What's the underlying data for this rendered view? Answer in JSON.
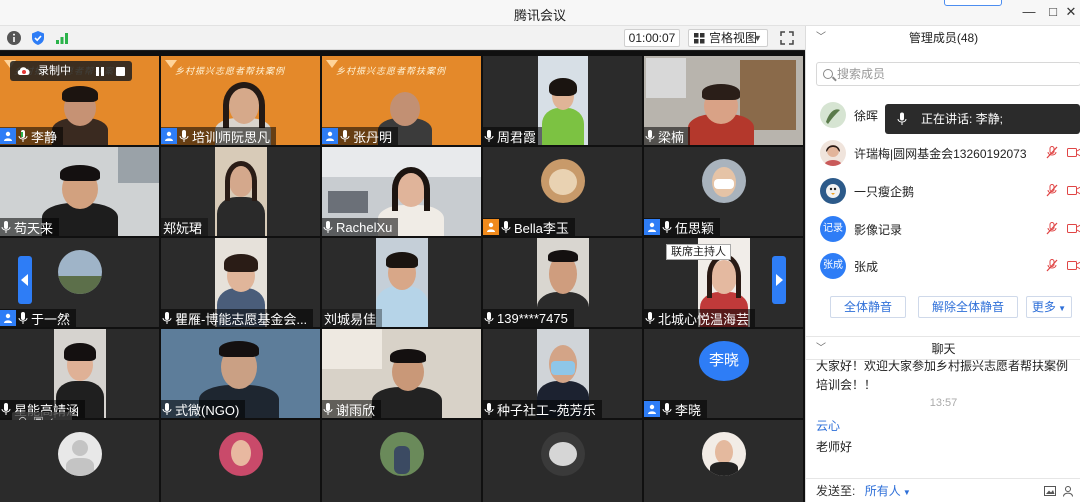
{
  "window": {
    "title": "腾讯会议",
    "controls": [
      "—",
      "□",
      "✕"
    ]
  },
  "toolbar": {
    "timer": "01:00:07",
    "view_mode": "宫格视图"
  },
  "recording": {
    "label": "录制中"
  },
  "tiles": [
    {
      "name": "李静",
      "role": "host"
    },
    {
      "name": "培训师阮思凡",
      "role": "host"
    },
    {
      "name": "张丹明",
      "role": "host"
    },
    {
      "name": "周君霞",
      "role": ""
    },
    {
      "name": "梁楠",
      "role": ""
    },
    {
      "name": "苟天来",
      "role": ""
    },
    {
      "name": "郑妧珺",
      "role": ""
    },
    {
      "name": "RachelXu",
      "role": ""
    },
    {
      "name": "Bella李玉",
      "role": "cohost"
    },
    {
      "name": "伍思颖",
      "role": "host"
    },
    {
      "name": "于一然",
      "role": "host"
    },
    {
      "name": "瞿雁-博能志愿基金会...",
      "role": ""
    },
    {
      "name": "刘城易佳",
      "role": ""
    },
    {
      "name": "139****7475",
      "role": ""
    },
    {
      "name": "北城心悦温海芸",
      "role": ""
    },
    {
      "name": "星能高靖涵",
      "role": ""
    },
    {
      "name": "式微(NGO)",
      "role": ""
    },
    {
      "name": "谢雨欣",
      "role": ""
    },
    {
      "name": "种子社工~苑芳乐",
      "role": ""
    },
    {
      "name": "李晓",
      "role": "host"
    }
  ],
  "tile_banner_text": "乡村振兴志愿者帮扶案例",
  "cohost_tooltip": "联席主持人",
  "avatar_text": "李晓",
  "panel": {
    "members_title": "管理成员(48)",
    "search_placeholder": "搜索成员",
    "members": [
      {
        "name": "徐晖",
        "avatar": ""
      },
      {
        "name": "许瑞梅|圆网基金会13260192073",
        "avatar": ""
      },
      {
        "name": "一只瘦企鹅",
        "avatar": ""
      },
      {
        "name": "影像记录",
        "avatar": "记录"
      },
      {
        "name": "张成",
        "avatar": "张成"
      }
    ],
    "speaking_label": "正在讲话: 李静;",
    "buttons": {
      "mute_all": "全体静音",
      "unmute_all": "解除全体静音",
      "more": "更多"
    },
    "chat_title": "聊天",
    "chat_line1": "大家好！欢迎大家参加乡村振兴志愿者帮扶案例",
    "chat_line2": "培训会！！",
    "chat_time": "13:57",
    "chat_sender": "云心",
    "chat_message": "老师好",
    "send_to_label": "发送至:",
    "send_to_value": "所有人"
  },
  "colors": {
    "accent": "#2e7df6",
    "banner_orange": "#e4892a",
    "cohost_orange": "#f08a1c"
  }
}
